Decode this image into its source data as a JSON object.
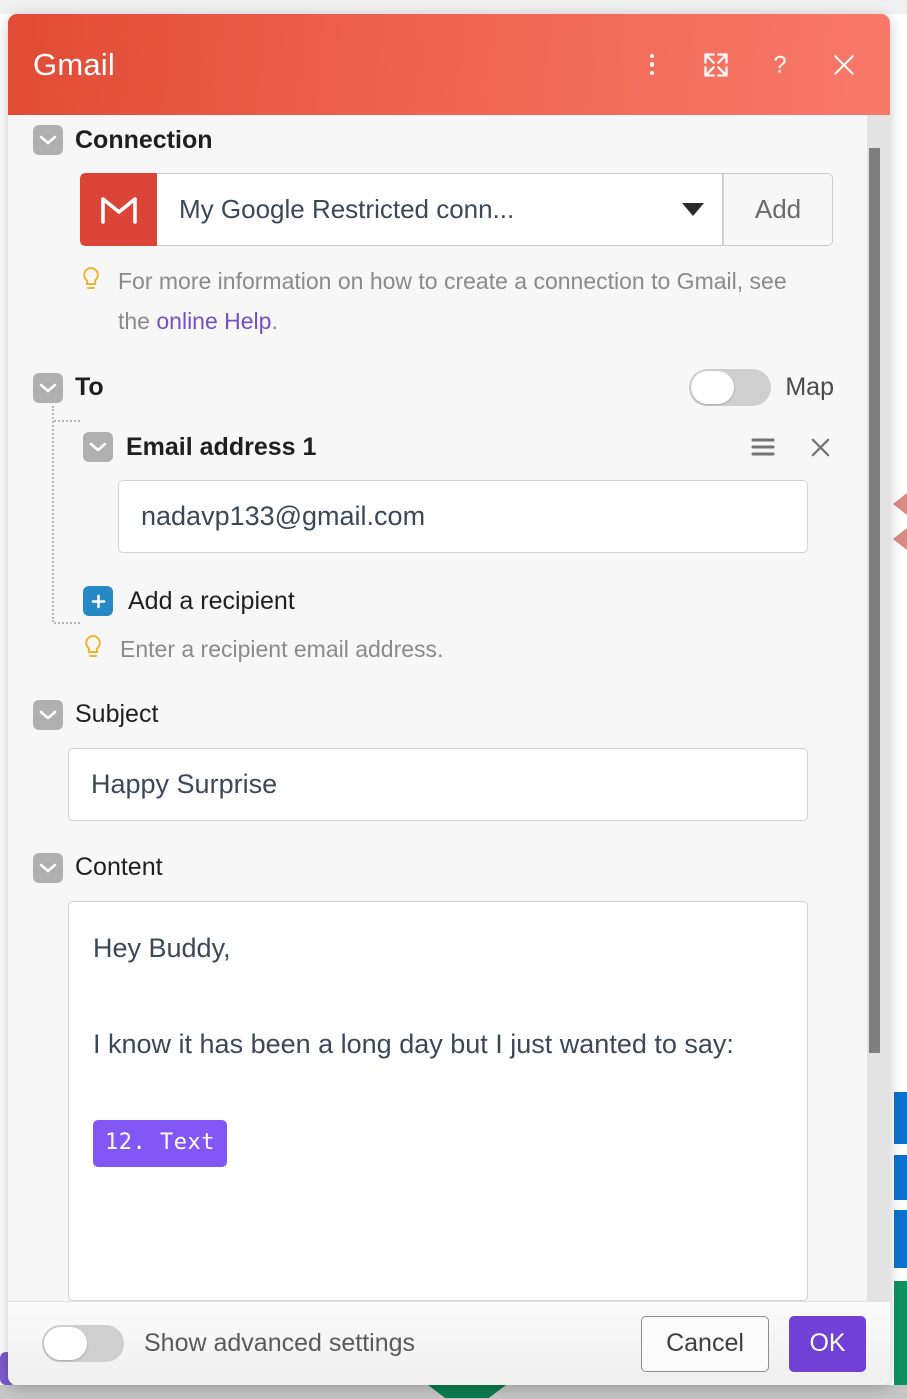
{
  "header": {
    "title": "Gmail",
    "icons": [
      {
        "name": "more-options-icon",
        "glyph": "vertical-dots"
      },
      {
        "name": "expand-icon",
        "glyph": "fullscreen-arrows"
      },
      {
        "name": "help-icon",
        "glyph": "question-mark"
      },
      {
        "name": "close-icon",
        "glyph": "x"
      }
    ],
    "colors": {
      "gradient_start": "#e14b35",
      "gradient_end": "#f8796a",
      "text": "#ffffff"
    }
  },
  "connection": {
    "label": "Connection",
    "app_icon": "gmail-logo-icon",
    "selected_value": "My Google Restricted conn...",
    "add_label": "Add",
    "hint_prefix": "For more information on how to create a connection to Gmail, see the ",
    "hint_link": "online Help",
    "hint_suffix": ".",
    "hint_icon": "lightbulb-icon"
  },
  "to": {
    "label": "To",
    "map_label": "Map",
    "map_enabled": false,
    "email_item": {
      "label": "Email address 1",
      "value": "nadavp133@gmail.com",
      "list_icon": "list-menu-icon",
      "remove_icon": "close-icon"
    },
    "add_recipient_label": "Add a recipient",
    "add_recipient_icon": "plus-icon",
    "hint": "Enter a recipient email address.",
    "hint_icon": "lightbulb-icon"
  },
  "subject": {
    "label": "Subject",
    "value": "Happy Surprise"
  },
  "content": {
    "label": "Content",
    "line1": "Hey Buddy,",
    "line2": "I know it has been a long day but I just wanted to say:",
    "token": "12. Text"
  },
  "footer": {
    "advanced_label": "Show advanced settings",
    "advanced_enabled": false,
    "cancel_label": "Cancel",
    "ok_label": "OK",
    "ok_color": "#7140d4"
  },
  "scrollbar": {
    "thumb_color": "#7f7f7f",
    "track_color": "#e3e3e3"
  }
}
